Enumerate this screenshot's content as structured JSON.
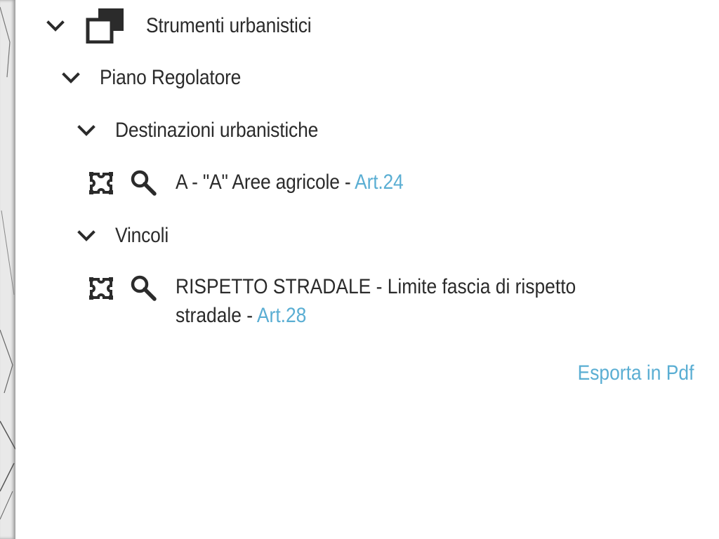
{
  "tree": {
    "root": {
      "label": "Strumenti urbanistici",
      "icon": "layers-icon",
      "expanded": true
    },
    "piano": {
      "label": "Piano Regolatore",
      "expanded": true
    },
    "destinazioni": {
      "label": "Destinazioni urbanistiche",
      "expanded": true,
      "item": {
        "text": "A - \"A\" Aree agricole - ",
        "link": "Art.24"
      }
    },
    "vincoli": {
      "label": "Vincoli",
      "expanded": true,
      "item": {
        "line1": "RISPETTO STRADALE - Limite fascia di rispetto",
        "line2": "stradale - ",
        "link": "Art.28"
      }
    }
  },
  "export": {
    "label": "Esporta in Pdf"
  },
  "colors": {
    "link": "#5aaed3",
    "text": "#2b2b2b"
  }
}
